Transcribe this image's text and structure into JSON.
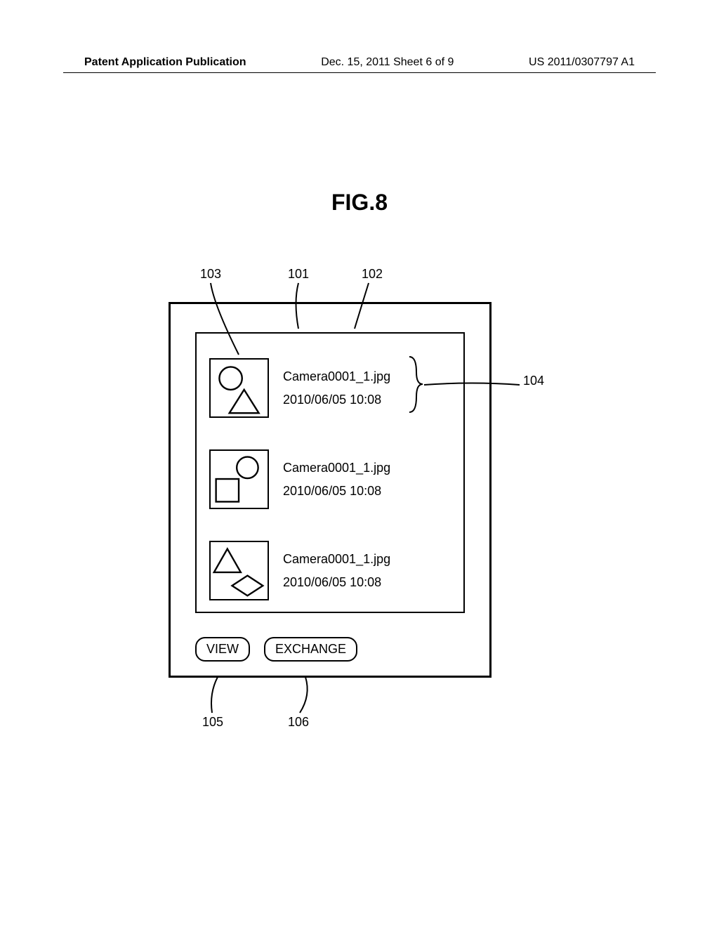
{
  "header": {
    "left": "Patent Application Publication",
    "center": "Dec. 15, 2011  Sheet 6 of 9",
    "right": "US 2011/0307797 A1"
  },
  "figure_title": "FIG.8",
  "refs": {
    "r101": "101",
    "r102": "102",
    "r103": "103",
    "r104": "104",
    "r105": "105",
    "r106": "106"
  },
  "list_items": [
    {
      "filename": "Camera0001_1.jpg",
      "timestamp": "2010/06/05 10:08"
    },
    {
      "filename": "Camera0001_1.jpg",
      "timestamp": "2010/06/05 10:08"
    },
    {
      "filename": "Camera0001_1.jpg",
      "timestamp": "2010/06/05 10:08"
    }
  ],
  "buttons": {
    "view": "VIEW",
    "exchange": "EXCHANGE"
  }
}
